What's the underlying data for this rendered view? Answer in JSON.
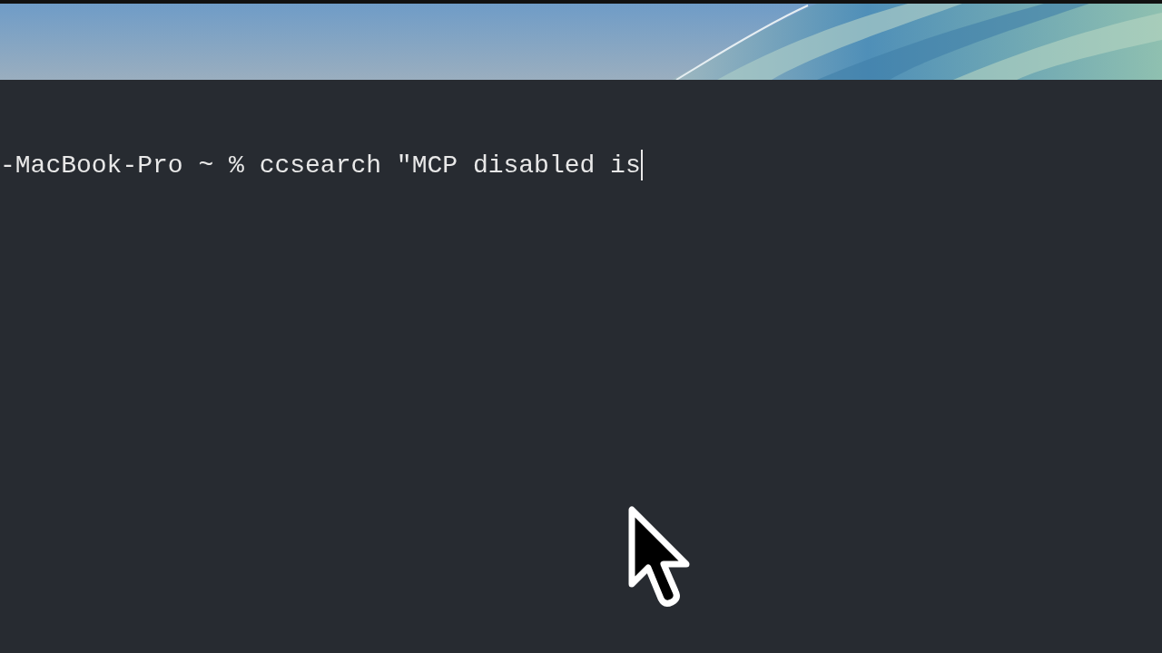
{
  "terminal": {
    "lines": [
      {
        "text": "-MacBook-Pro ~ % ccsearch \"MCP disabled is",
        "cursor": true
      }
    ]
  }
}
